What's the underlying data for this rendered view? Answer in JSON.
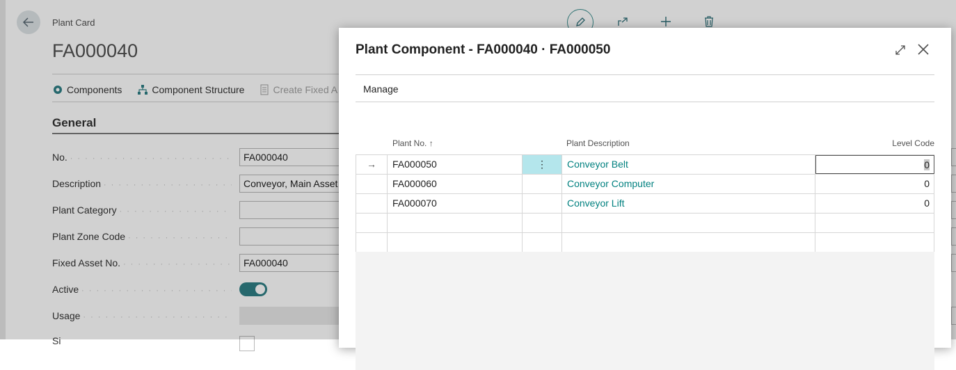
{
  "background": {
    "caption": "Plant Card",
    "title": "FA000040",
    "actions": [
      {
        "label": "Components",
        "icon": "gear-icon"
      },
      {
        "label": "Component Structure",
        "icon": "hierarchy-icon"
      },
      {
        "label": "Create Fixed A",
        "icon": "document-icon"
      }
    ],
    "section": "General",
    "fields": [
      {
        "label": "No.",
        "value": "FA000040"
      },
      {
        "label": "Description",
        "value": "Conveyor, Main Asset"
      },
      {
        "label": "Plant Category",
        "value": ""
      },
      {
        "label": "Plant Zone Code",
        "value": ""
      },
      {
        "label": "Fixed Asset No.",
        "value": "FA000040"
      },
      {
        "label": "Active",
        "value": ""
      },
      {
        "label": "Usage",
        "value": ""
      },
      {
        "label": "Si",
        "value": ""
      }
    ],
    "dots": "· · · · · · · · · · · · · · · · · · · · · · · · · · · · · · · · · · · · · · · · · · · · · · ·"
  },
  "dialog": {
    "title": "Plant Component - FA000040 · FA000050",
    "menu": "Manage",
    "columns": {
      "plant_no": "Plant No. ↑",
      "description": "Plant Description",
      "level_code": "Level Code"
    },
    "row_arrow": "→",
    "row_menu": "⋮",
    "rows": [
      {
        "plant_no": "FA000050",
        "description": "Conveyor Belt",
        "level_code": "0"
      },
      {
        "plant_no": "FA000060",
        "description": "Conveyor Computer",
        "level_code": "0"
      },
      {
        "plant_no": "FA000070",
        "description": "Conveyor Lift",
        "level_code": "0"
      }
    ]
  },
  "colors": {
    "accent": "#00807f",
    "selected_cell": "#b4e6ec",
    "toggle_on": "#2f7f85"
  }
}
